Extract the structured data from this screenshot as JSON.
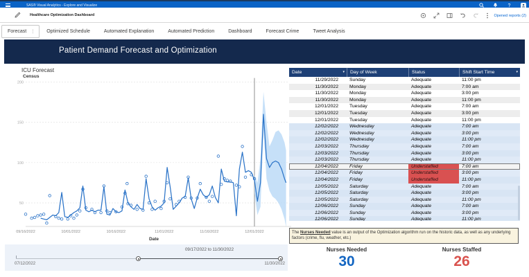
{
  "app_bar": {
    "title": "SAS® Visual Analytics - Explore and Visualize"
  },
  "toolbar": {
    "report_title": "Healthcare Optimization Dashboard",
    "opened_reports_label": "Opened reports (2)"
  },
  "tabs": [
    "Forecast",
    "Optimized Schedule",
    "Automated Explanation",
    "Automated Prediction",
    "Dashboard",
    "Forecast Crime",
    "Tweet Analysis"
  ],
  "active_tab": "Forecast",
  "banner": {
    "title": "Patient Demand Forecast and Optimization"
  },
  "chart_data": {
    "type": "line",
    "title": "ICU Forecast",
    "xlabel": "Date",
    "ylabel": "Census",
    "x_ticks": [
      {
        "day": 0,
        "label": "09/16/2022"
      },
      {
        "day": 15,
        "label": "10/01/2022"
      },
      {
        "day": 30,
        "label": "10/16/2022"
      },
      {
        "day": 46,
        "label": "11/01/2022"
      },
      {
        "day": 61,
        "label": "11/16/2022"
      },
      {
        "day": 76,
        "label": "12/01/2022"
      }
    ],
    "y_ticks": [
      50,
      100,
      150,
      200
    ],
    "ylim": [
      21,
      205
    ],
    "reference_line_day": 76,
    "reference_line_label": "forecast-start",
    "series": [
      {
        "name": "model-fit",
        "type": "line",
        "points": [
          [
            5,
            31
          ],
          [
            6,
            30
          ],
          [
            7,
            29
          ],
          [
            8,
            32
          ],
          [
            9,
            35
          ],
          [
            10,
            34
          ],
          [
            11,
            38
          ],
          [
            12,
            63
          ],
          [
            13,
            33
          ],
          [
            14,
            32
          ],
          [
            15,
            35
          ],
          [
            16,
            38
          ],
          [
            17,
            40
          ],
          [
            18,
            44
          ],
          [
            19,
            71
          ],
          [
            20,
            41
          ],
          [
            21,
            39
          ],
          [
            22,
            41
          ],
          [
            23,
            39
          ],
          [
            24,
            41
          ],
          [
            25,
            41
          ],
          [
            26,
            70
          ],
          [
            27,
            36
          ],
          [
            28,
            35
          ],
          [
            29,
            43
          ],
          [
            30,
            39
          ],
          [
            31,
            38
          ],
          [
            32,
            40
          ],
          [
            33,
            66
          ],
          [
            34,
            50
          ],
          [
            35,
            45
          ],
          [
            36,
            42
          ],
          [
            37,
            48
          ],
          [
            38,
            43
          ],
          [
            39,
            42
          ],
          [
            40,
            80
          ],
          [
            41,
            55
          ],
          [
            42,
            45
          ],
          [
            43,
            41
          ],
          [
            44,
            44
          ],
          [
            45,
            46
          ],
          [
            46,
            50
          ],
          [
            47,
            94
          ],
          [
            48,
            70
          ],
          [
            49,
            42
          ],
          [
            50,
            46
          ],
          [
            51,
            50
          ],
          [
            52,
            56
          ],
          [
            53,
            58
          ],
          [
            54,
            81
          ],
          [
            55,
            55
          ],
          [
            56,
            43
          ],
          [
            57,
            56
          ],
          [
            58,
            67
          ],
          [
            59,
            60
          ],
          [
            60,
            57
          ],
          [
            61,
            60
          ],
          [
            62,
            71
          ],
          [
            63,
            57
          ],
          [
            64,
            50
          ],
          [
            65,
            92
          ],
          [
            66,
            77
          ],
          [
            67,
            76
          ],
          [
            68,
            76
          ],
          [
            69,
            75
          ],
          [
            70,
            34
          ],
          [
            71,
            92
          ],
          [
            72,
            113
          ],
          [
            73,
            88
          ],
          [
            74,
            90
          ],
          [
            75,
            88
          ],
          [
            76,
            78
          ]
        ]
      },
      {
        "name": "forecast",
        "type": "line",
        "points": [
          [
            76,
            78
          ],
          [
            77,
            52
          ],
          [
            78,
            75
          ],
          [
            79,
            160
          ],
          [
            80,
            105
          ],
          [
            81,
            94
          ],
          [
            82,
            100
          ],
          [
            83,
            102
          ],
          [
            84,
            100
          ],
          [
            85,
            92
          ],
          [
            86,
            80
          ],
          [
            86.5,
            75
          ]
        ]
      },
      {
        "name": "confidence-band",
        "type": "band",
        "points": [
          [
            76,
            62,
            85
          ],
          [
            77,
            35,
            75
          ],
          [
            78,
            45,
            105
          ],
          [
            79,
            140,
            188
          ],
          [
            80,
            80,
            150
          ],
          [
            81,
            65,
            120
          ],
          [
            82,
            58,
            128
          ],
          [
            83,
            55,
            138
          ],
          [
            84,
            50,
            140
          ],
          [
            85,
            42,
            135
          ],
          [
            86,
            30,
            125
          ],
          [
            86.5,
            20,
            115
          ]
        ]
      },
      {
        "name": "actual-census",
        "type": "scatter",
        "points": [
          [
            0,
            36
          ],
          [
            2,
            31
          ],
          [
            3,
            32
          ],
          [
            4,
            34
          ],
          [
            5,
            35
          ],
          [
            6,
            36
          ],
          [
            7,
            25
          ],
          [
            8,
            59
          ],
          [
            10,
            33
          ],
          [
            11,
            31
          ],
          [
            12,
            30
          ],
          [
            14,
            30
          ],
          [
            15,
            34
          ],
          [
            16,
            31
          ],
          [
            17,
            35
          ],
          [
            18,
            40
          ],
          [
            19,
            67
          ],
          [
            20,
            44
          ],
          [
            22,
            42
          ],
          [
            23,
            38
          ],
          [
            25,
            38
          ],
          [
            26,
            71
          ],
          [
            27,
            40
          ],
          [
            28,
            38
          ],
          [
            30,
            39
          ],
          [
            32,
            45
          ],
          [
            33,
            62
          ],
          [
            33.7,
            74
          ],
          [
            34,
            49
          ],
          [
            35,
            47
          ],
          [
            37,
            42
          ],
          [
            39,
            41
          ],
          [
            40,
            83
          ],
          [
            41,
            50
          ],
          [
            42,
            42
          ],
          [
            43,
            52
          ],
          [
            45,
            43
          ],
          [
            46,
            52
          ],
          [
            47,
            75
          ],
          [
            48,
            55
          ],
          [
            50,
            48
          ],
          [
            51,
            52
          ],
          [
            53,
            57
          ],
          [
            54,
            82
          ],
          [
            55,
            56
          ],
          [
            57,
            56
          ],
          [
            58,
            74
          ],
          [
            60,
            57
          ],
          [
            61,
            52
          ],
          [
            62,
            58
          ],
          [
            64,
            108
          ],
          [
            65,
            73
          ],
          [
            66,
            80
          ],
          [
            67,
            78
          ],
          [
            68,
            77
          ],
          [
            70,
            72
          ],
          [
            71,
            70
          ],
          [
            72,
            120
          ],
          [
            73,
            82
          ],
          [
            75,
            85
          ],
          [
            76,
            80
          ]
        ]
      }
    ]
  },
  "slider": {
    "range_label": "09/17/2022 to 11/30/2022",
    "min_label": "07/12/2022",
    "max_label": "11/30/2022"
  },
  "table": {
    "columns": [
      "Date",
      "Day of Week",
      "Status",
      "Shift Start Time"
    ],
    "sorted_columns": [
      "Date",
      "Shift Start Time"
    ],
    "rows": [
      {
        "date": "11/29/2022",
        "day": "Sunday",
        "status": "Adequate",
        "shift": "11:00 pm",
        "forecast": false,
        "selected": false
      },
      {
        "date": "11/30/2022",
        "day": "Monday",
        "status": "Adequate",
        "shift": "7:00 am",
        "forecast": false,
        "selected": false
      },
      {
        "date": "11/30/2022",
        "day": "Monday",
        "status": "Adequate",
        "shift": "3:00 pm",
        "forecast": false,
        "selected": false
      },
      {
        "date": "11/30/2022",
        "day": "Monday",
        "status": "Adequate",
        "shift": "11:00 pm",
        "forecast": false,
        "selected": false
      },
      {
        "date": "12/01/2022",
        "day": "Tuesday",
        "status": "Adequate",
        "shift": "7:00 am",
        "forecast": false,
        "selected": false
      },
      {
        "date": "12/01/2022",
        "day": "Tuesday",
        "status": "Adequate",
        "shift": "3:00 pm",
        "forecast": false,
        "selected": false
      },
      {
        "date": "12/01/2022",
        "day": "Tuesday",
        "status": "Adequate",
        "shift": "11:00 pm",
        "forecast": false,
        "selected": false
      },
      {
        "date": "12/02/2022",
        "day": "Wednesday",
        "status": "Adequate",
        "shift": "7:00 am",
        "forecast": true,
        "selected": false
      },
      {
        "date": "12/02/2022",
        "day": "Wednesday",
        "status": "Adequate",
        "shift": "3:00 pm",
        "forecast": true,
        "selected": false
      },
      {
        "date": "12/02/2022",
        "day": "Wednesday",
        "status": "Adequate",
        "shift": "11:00 pm",
        "forecast": true,
        "selected": false
      },
      {
        "date": "12/03/2022",
        "day": "Thursday",
        "status": "Adequate",
        "shift": "7:00 am",
        "forecast": true,
        "selected": false
      },
      {
        "date": "12/03/2022",
        "day": "Thursday",
        "status": "Adequate",
        "shift": "3:00 pm",
        "forecast": true,
        "selected": false
      },
      {
        "date": "12/03/2022",
        "day": "Thursday",
        "status": "Adequate",
        "shift": "11:00 pm",
        "forecast": true,
        "selected": false
      },
      {
        "date": "12/04/2022",
        "day": "Friday",
        "status": "Understaffed",
        "shift": "7:00 am",
        "forecast": true,
        "selected": true
      },
      {
        "date": "12/04/2022",
        "day": "Friday",
        "status": "Understaffed",
        "shift": "3:00 pm",
        "forecast": true,
        "selected": false
      },
      {
        "date": "12/04/2022",
        "day": "Friday",
        "status": "Understaffed",
        "shift": "11:00 pm",
        "forecast": true,
        "selected": false
      },
      {
        "date": "12/05/2022",
        "day": "Saturday",
        "status": "Adequate",
        "shift": "7:00 am",
        "forecast": true,
        "selected": false
      },
      {
        "date": "12/05/2022",
        "day": "Saturday",
        "status": "Adequate",
        "shift": "3:00 pm",
        "forecast": true,
        "selected": false
      },
      {
        "date": "12/05/2022",
        "day": "Saturday",
        "status": "Adequate",
        "shift": "11:00 pm",
        "forecast": true,
        "selected": false
      },
      {
        "date": "12/06/2022",
        "day": "Sunday",
        "status": "Adequate",
        "shift": "7:00 am",
        "forecast": true,
        "selected": false
      },
      {
        "date": "12/06/2022",
        "day": "Sunday",
        "status": "Adequate",
        "shift": "3:00 pm",
        "forecast": true,
        "selected": false
      },
      {
        "date": "12/06/2022",
        "day": "Sunday",
        "status": "Adequate",
        "shift": "11:00 pm",
        "forecast": true,
        "selected": false
      }
    ]
  },
  "note": {
    "prefix": "The ",
    "term": "Nurses Needed",
    "suffix": " value is an output of the Optimization algorithm run on the historic data, as well as any underlying factors (crime, flu, weather, etc.)"
  },
  "kpis": [
    {
      "label": "Nurses Needed",
      "value": "30",
      "color": "#1466c2"
    },
    {
      "label": "Nurses Staffed",
      "value": "26",
      "color": "#d9534e"
    }
  ],
  "colors": {
    "app_bar": "#0a63c6",
    "banner": "#14294d",
    "table_header": "#1e4076",
    "line": "#2c74c8",
    "band": "#b3d6f5",
    "understaffed_bg": "#d95151",
    "forecast_row_bg": "#d9e7f5",
    "alt_row_bg": "#ededed"
  }
}
